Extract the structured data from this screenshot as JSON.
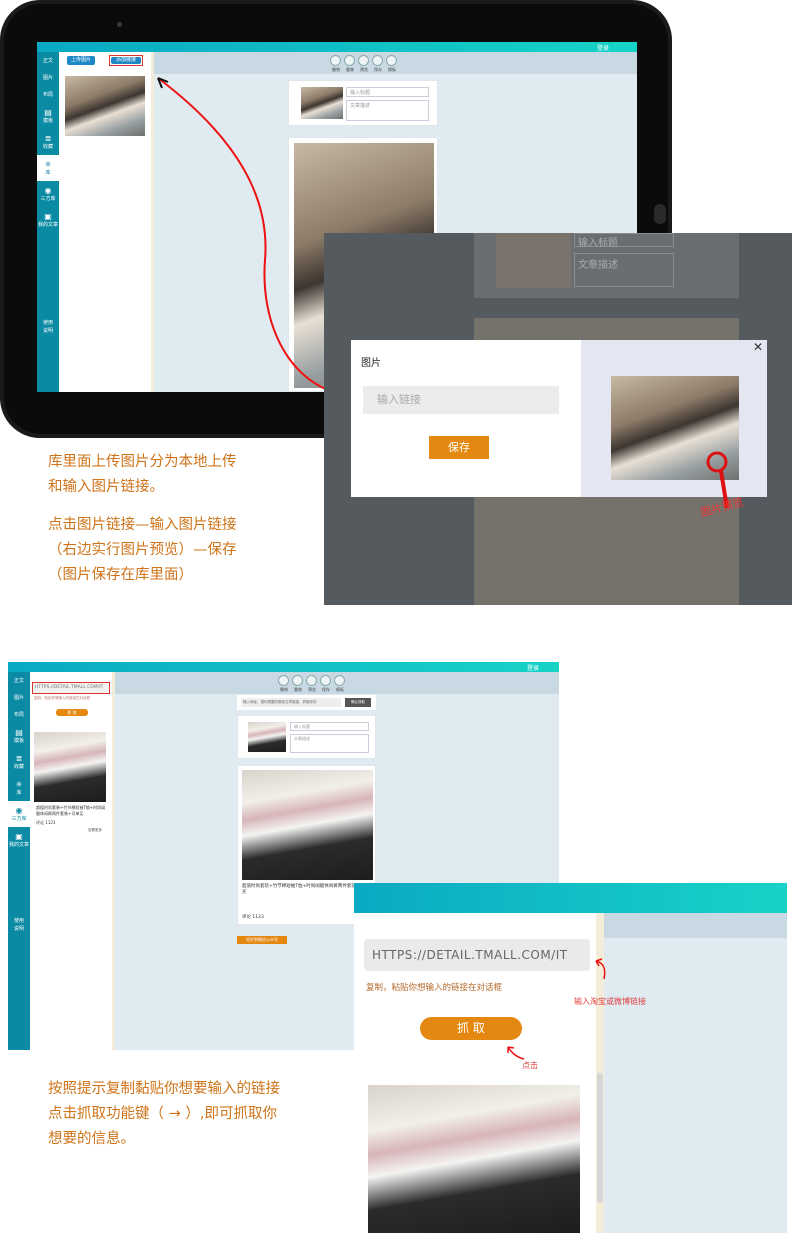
{
  "top_app": {
    "login": "登录",
    "nav": [
      "正文",
      "图片",
      "布局",
      "模板",
      "收藏",
      "库",
      "三方库",
      "我的文章"
    ],
    "nav_help": "使用说明",
    "btn_upload": "上传图片",
    "btn_add_link": "添加链接",
    "tools": [
      "撤销",
      "重做",
      "预览",
      "保存",
      "模板"
    ],
    "field_title": "输入标题",
    "field_desc": "文章描述"
  },
  "modal": {
    "title": "图片",
    "input_placeholder": "输入链接",
    "save": "保存",
    "close_icon": "close-icon",
    "preview_label": "图片预览",
    "bg_field_title": "输入标题",
    "bg_field_desc": "文章描述"
  },
  "caption1": {
    "line1": "库里面上传图片分为本地上传",
    "line2": "和输入图片链接。",
    "line3": "点击图片链接—输入图片链接",
    "line4": "（右边实行图片预览）—保存",
    "line5": "（图片保存在库里面）"
  },
  "bottom_app": {
    "login": "登录",
    "nav": [
      "正文",
      "图片",
      "布局",
      "模板",
      "收藏",
      "库",
      "三方库",
      "我的文章"
    ],
    "nav_help": "使用说明",
    "url_value": "HTTPS://DETAIL.TMALL.COM/IT",
    "hint_small": "复制，粘贴你想输入的链接在对话框",
    "grab": "抓 取",
    "product_title": "超值时尚套装+竹节棉短袖T恤+时尚阔腿休闲裤两件套装+可单买",
    "comment": "评论 1123",
    "view_more": "查看更多",
    "tools": [
      "撤销",
      "重做",
      "预览",
      "保存",
      "模板"
    ],
    "search_placeholder": "输入网址，搜你想要的微信文章链接，抓取你的",
    "search_btn": "确认抓取",
    "field_title": "输入标题",
    "field_desc": "文章描述",
    "sync_btn": "同步到微信公众号"
  },
  "zoom": {
    "url_value": "HTTPS://DETAIL.TMALL.COM/IT",
    "hint": "复制，粘贴你想输入的链接在对话框",
    "grab": "抓 取",
    "annotation_input": "输入淘宝或微博链接",
    "annotation_click": "点击"
  },
  "caption2": {
    "line1": "按照提示复制黏贴你想要输入的链接",
    "line2": "点击抓取功能键（ → ）,即可抓取你",
    "line3": "想要的信息。"
  },
  "colors": {
    "accent_orange": "#e48812",
    "caption_brown": "#cf7318",
    "nav_teal": "#0b8aa3",
    "annotation_red": "#e04040"
  }
}
